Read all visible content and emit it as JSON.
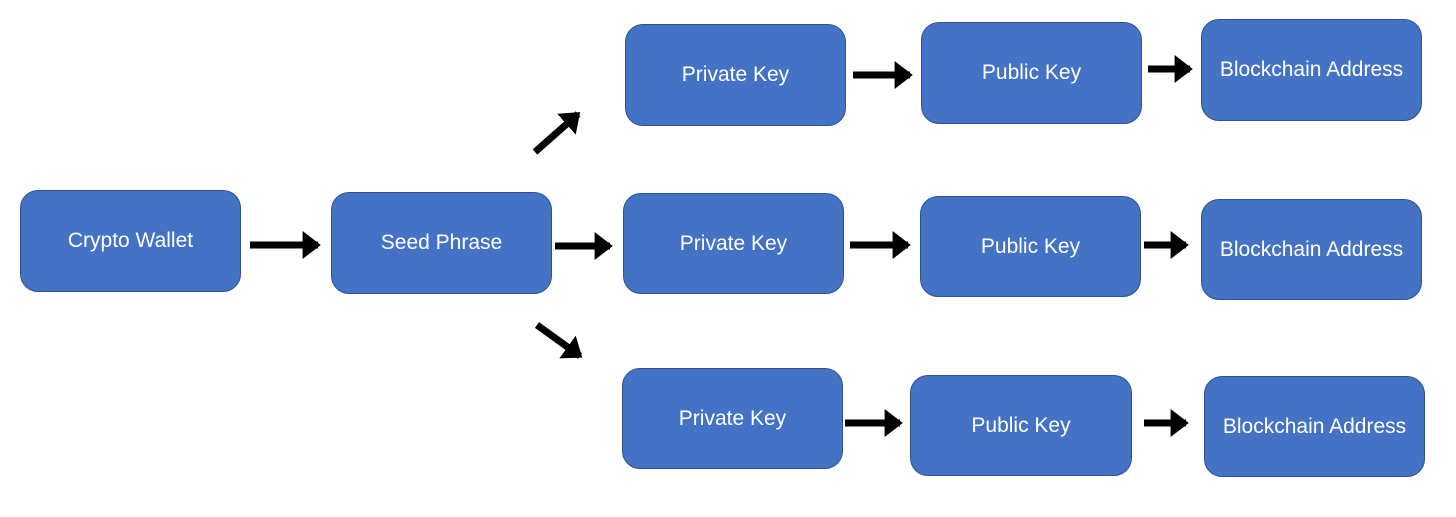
{
  "diagram": {
    "title": "",
    "colors": {
      "node_fill": "#4472c4",
      "node_border": "#2f528f",
      "node_text": "#ffffff",
      "arrow": "#000000"
    },
    "nodes": {
      "wallet": {
        "label": "Crypto Wallet"
      },
      "seed": {
        "label": "Seed Phrase"
      },
      "branches": [
        {
          "private_key": "Private Key",
          "public_key": "Public Key",
          "address": "Blockchain Address"
        },
        {
          "private_key": "Private Key",
          "public_key": "Public Key",
          "address": "Blockchain Address"
        },
        {
          "private_key": "Private Key",
          "public_key": "Public Key",
          "address": "Blockchain Address"
        }
      ]
    },
    "edges": [
      [
        "Crypto Wallet",
        "Seed Phrase"
      ],
      [
        "Seed Phrase",
        "Private Key (1)"
      ],
      [
        "Seed Phrase",
        "Private Key (2)"
      ],
      [
        "Seed Phrase",
        "Private Key (3)"
      ],
      [
        "Private Key (1)",
        "Public Key (1)"
      ],
      [
        "Private Key (2)",
        "Public Key (2)"
      ],
      [
        "Private Key (3)",
        "Public Key (3)"
      ],
      [
        "Public Key (1)",
        "Blockchain Address (1)"
      ],
      [
        "Public Key (2)",
        "Blockchain Address (2)"
      ],
      [
        "Public Key (3)",
        "Blockchain Address (3)"
      ]
    ]
  }
}
